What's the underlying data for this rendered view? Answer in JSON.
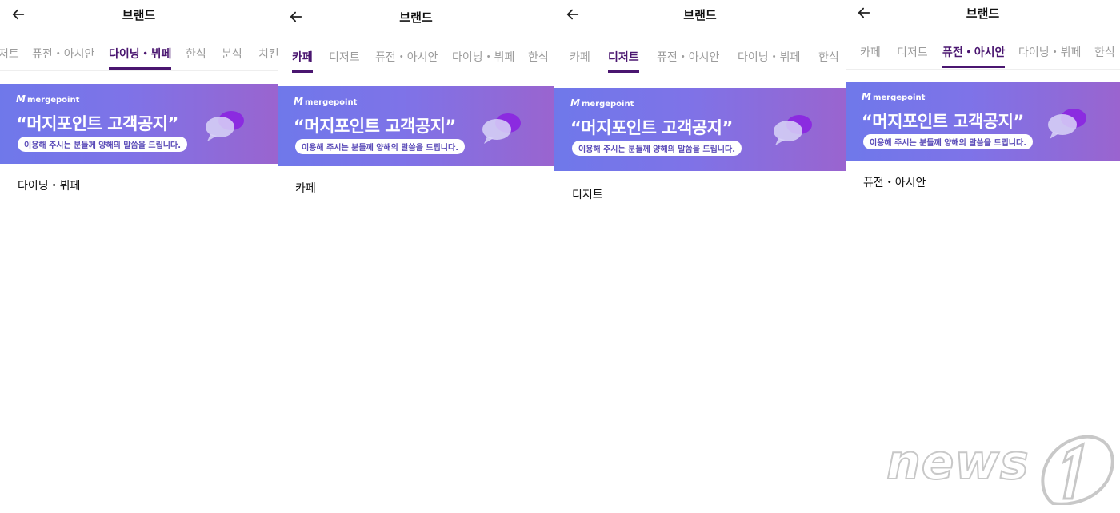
{
  "banner": {
    "brand": "mergepoint",
    "headline": "“머지포인트 고객공지”",
    "sub": "이용해 주시는 분들께 양해의 말씀을 드립니다."
  },
  "panels": [
    {
      "title": "브랜드",
      "tabs": [
        "저트",
        "퓨전・아시안",
        "다이닝・뷔페",
        "한식",
        "분식",
        "치킨"
      ],
      "active_tab": "다이닝・뷔페",
      "content": "다이닝・뷔페"
    },
    {
      "title": "브랜드",
      "tabs": [
        "카페",
        "디저트",
        "퓨전・아시안",
        "다이닝・뷔페",
        "한식"
      ],
      "active_tab": "카페",
      "content": "카페"
    },
    {
      "title": "브랜드",
      "tabs": [
        "카페",
        "디저트",
        "퓨전・아시안",
        "다이닝・뷔페",
        "한식"
      ],
      "active_tab": "디저트",
      "content": "디저트"
    },
    {
      "title": "브랜드",
      "tabs": [
        "카페",
        "디저트",
        "퓨전・아시안",
        "다이닝・뷔페",
        "한식"
      ],
      "active_tab": "퓨전・아시안",
      "content": "퓨전・아시안"
    }
  ],
  "watermark": {
    "text": "news",
    "mark": "1"
  },
  "colors": {
    "accent": "#4a1670",
    "inactive_tab": "#9c9c9c",
    "banner_start": "#6f78ea",
    "banner_end": "#9a64cf"
  }
}
